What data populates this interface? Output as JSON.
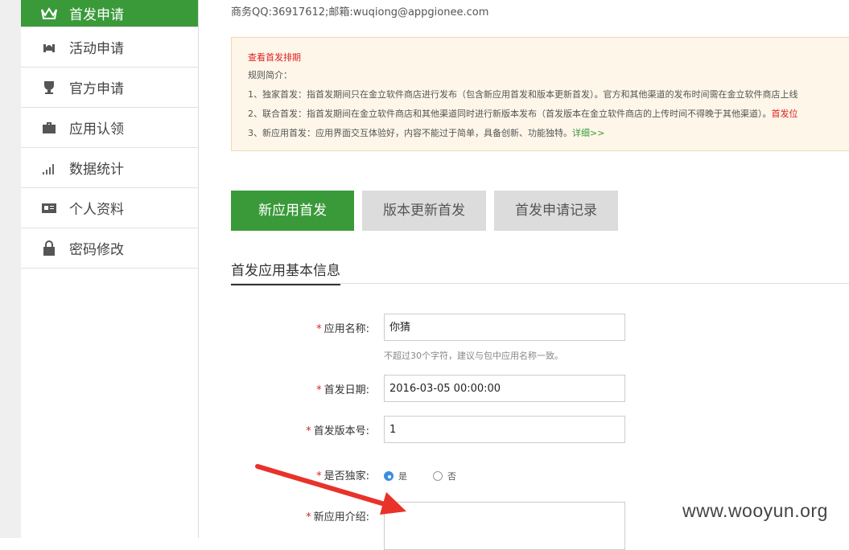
{
  "sidebar": {
    "items": [
      {
        "label": "首发申请",
        "icon": "crown-icon"
      },
      {
        "label": "活动申请",
        "icon": "hands-icon"
      },
      {
        "label": "官方申请",
        "icon": "trophy-icon"
      },
      {
        "label": "应用认领",
        "icon": "briefcase-icon"
      },
      {
        "label": "数据统计",
        "icon": "bar-chart-icon"
      },
      {
        "label": "个人资料",
        "icon": "id-card-icon"
      },
      {
        "label": "密码修改",
        "icon": "lock-icon"
      }
    ]
  },
  "contact": "商务QQ:36917612;邮箱:wuqiong@appgionee.com",
  "notice": {
    "title": "查看首发排期",
    "intro": "规则简介：",
    "rule1": "1、独家首发：指首发期间只在金立软件商店进行发布（包含新应用首发和版本更新首发）。官方和其他渠道的发布时间需在金立软件商店上线",
    "rule2": "2、联合首发：指首发期间在金立软件商店和其他渠道同时进行新版本发布（首发版本在金立软件商店的上传时间不得晚于其他渠道）。",
    "rule2_red": "首发位",
    "rule3": "3、新应用首发：应用界面交互体验好，内容不能过于简单，具备创新、功能独特。",
    "rule3_link": "详细>>"
  },
  "tabs": [
    "新应用首发",
    "版本更新首发",
    "首发申请记录"
  ],
  "section_title": "首发应用基本信息",
  "form": {
    "app_name_label": "应用名称:",
    "app_name_value": "你猜",
    "app_name_hint": "不超过30个字符，建议与包中应用名称一致。",
    "date_label": "首发日期:",
    "date_value": "2016-03-05 00:00:00",
    "version_label": "首发版本号:",
    "version_value": "1",
    "exclusive_label": "是否独家:",
    "exclusive_yes": "是",
    "exclusive_no": "否",
    "exclusive_selected": "是",
    "intro_label": "新应用介绍:"
  },
  "watermark": "www.wooyun.org",
  "colors": {
    "accent": "#3a9a3a",
    "required": "#e02020",
    "arrow": "#e8322a",
    "radio": "#3d8ee0"
  }
}
